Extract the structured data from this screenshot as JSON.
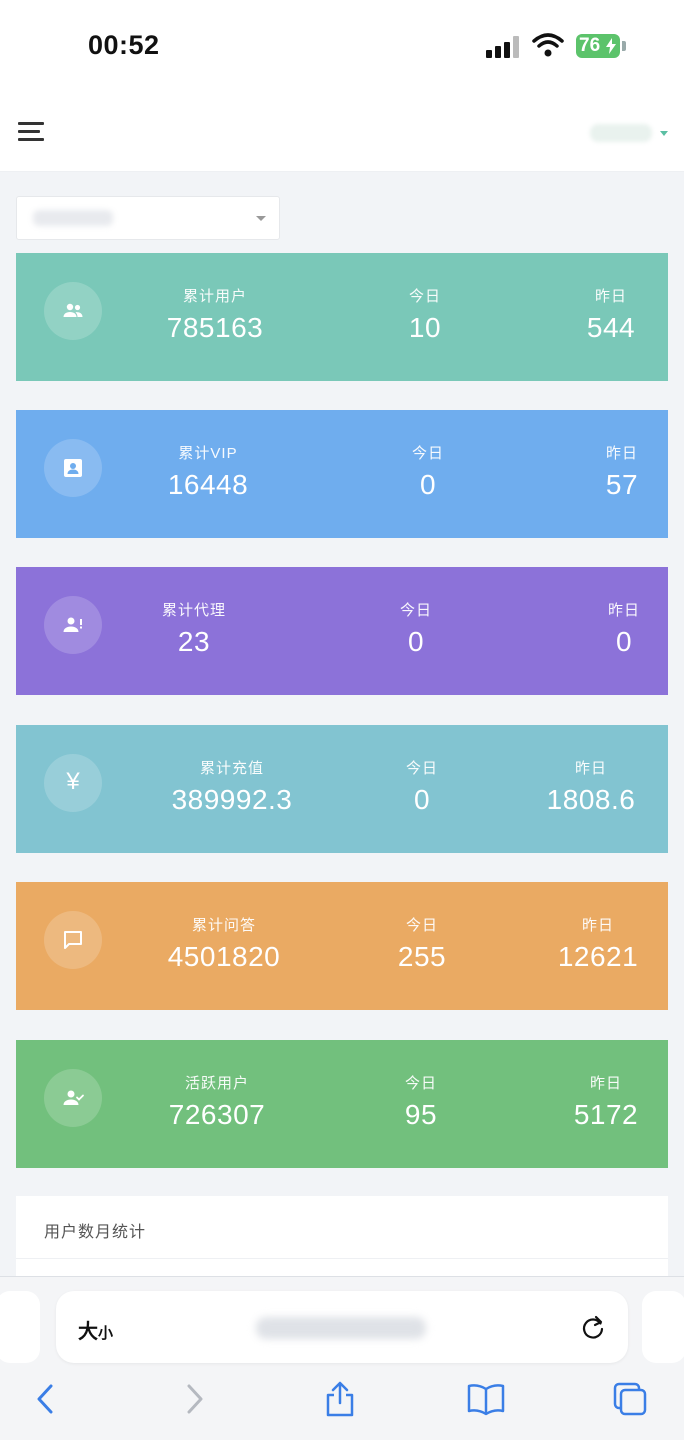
{
  "status_bar": {
    "time": "00:52",
    "battery": "76"
  },
  "stats": [
    {
      "label": "累计用户",
      "value": "785163",
      "today_label": "今日",
      "today": "10",
      "yesterday_label": "昨日",
      "yesterday": "544",
      "color": "#7ac8b8",
      "icon": "users-icon"
    },
    {
      "label": "累计VIP",
      "value": "16448",
      "today_label": "今日",
      "today": "0",
      "yesterday_label": "昨日",
      "yesterday": "57",
      "color": "#6fadee",
      "icon": "contact-card-icon"
    },
    {
      "label": "累计代理",
      "value": "23",
      "today_label": "今日",
      "today": "0",
      "yesterday_label": "昨日",
      "yesterday": "0",
      "color": "#8c72d9",
      "icon": "user-alert-icon"
    },
    {
      "label": "累计充值",
      "value": "389992.3",
      "today_label": "今日",
      "today": "0",
      "yesterday_label": "昨日",
      "yesterday": "1808.6",
      "color": "#82c4d1",
      "icon": "yen-icon",
      "icon_glyph": "¥"
    },
    {
      "label": "累计问答",
      "value": "4501820",
      "today_label": "今日",
      "today": "255",
      "yesterday_label": "昨日",
      "yesterday": "12621",
      "color": "#eaaa63",
      "icon": "chat-icon"
    },
    {
      "label": "活跃用户",
      "value": "726307",
      "today_label": "今日",
      "today": "95",
      "yesterday_label": "昨日",
      "yesterday": "5172",
      "color": "#72c07d",
      "icon": "user-check-icon"
    }
  ],
  "panel": {
    "title": "用户数月统计"
  },
  "browser": {
    "text_size_label_big": "大",
    "text_size_label_small": "小"
  }
}
